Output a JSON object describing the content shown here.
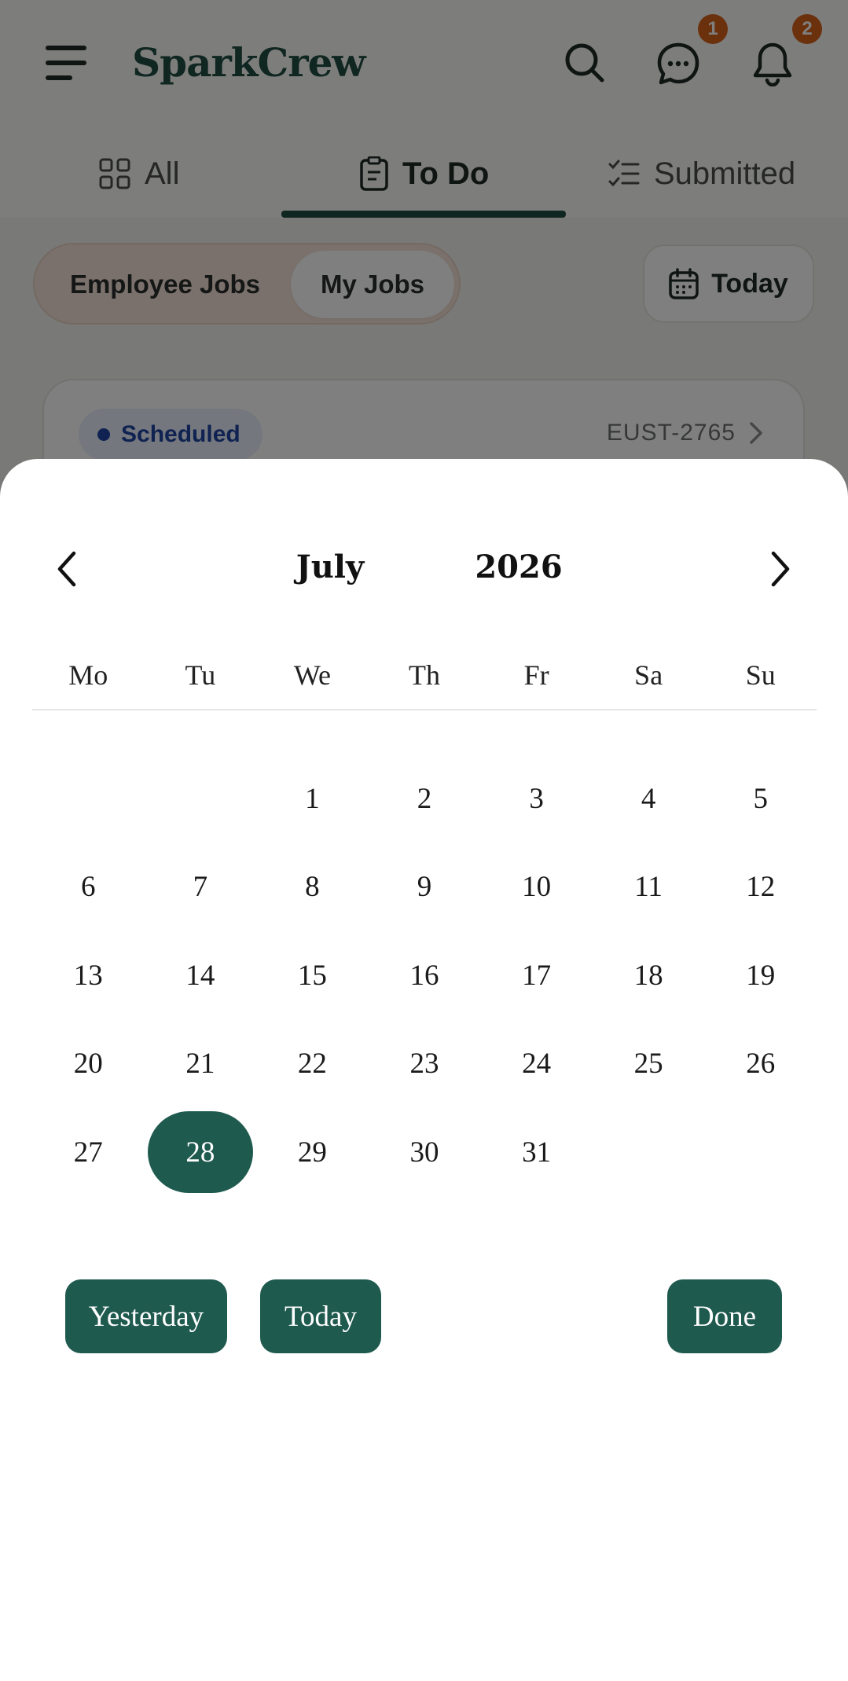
{
  "header": {
    "brand": "SparkCrew",
    "messages_badge": "1",
    "notifications_badge": "2"
  },
  "tabs": [
    {
      "label": "All",
      "icon": "grid-icon"
    },
    {
      "label": "To Do",
      "icon": "clipboard-icon",
      "active": true
    },
    {
      "label": "Submitted",
      "icon": "checklist-icon"
    }
  ],
  "filters": {
    "segments": [
      "Employee Jobs",
      "My Jobs"
    ],
    "selected_segment": "My Jobs",
    "date_button": "Today"
  },
  "job_card": {
    "status": "Scheduled",
    "id": "EUST-2765"
  },
  "calendar": {
    "month": "July",
    "year": "2026",
    "weekdays": [
      "Mo",
      "Tu",
      "We",
      "Th",
      "Fr",
      "Sa",
      "Su"
    ],
    "leading_blanks": 2,
    "days": [
      "1",
      "2",
      "3",
      "4",
      "5",
      "6",
      "7",
      "8",
      "9",
      "10",
      "11",
      "12",
      "13",
      "14",
      "15",
      "16",
      "17",
      "18",
      "19",
      "20",
      "21",
      "22",
      "23",
      "24",
      "25",
      "26",
      "27",
      "28",
      "29",
      "30",
      "31"
    ],
    "selected_day": "28"
  },
  "actions": {
    "yesterday": "Yesterday",
    "today": "Today",
    "done": "Done"
  },
  "colors": {
    "brand": "#1f4d43",
    "accent": "#1f5a4f",
    "badge": "#d7631a",
    "status_blue": "#1f45a3"
  }
}
